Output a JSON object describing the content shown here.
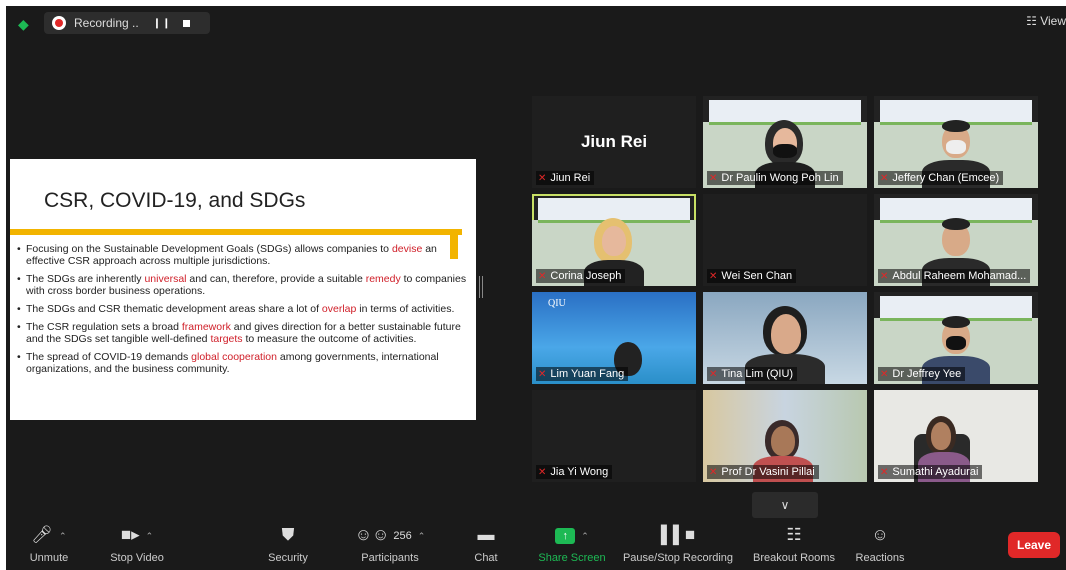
{
  "topbar": {
    "recording_label": "Recording ..",
    "pause_icon": "pause-icon",
    "stop_icon": "stop-icon",
    "view_label": "View"
  },
  "slide": {
    "title": "CSR, COVID-19, and SDGs",
    "bullets": [
      {
        "parts": [
          "Focusing on the Sustainable Development Goals (SDGs) allows companies to ",
          "devise",
          " an effective CSR approach across multiple jurisdictions."
        ]
      },
      {
        "parts": [
          "The SDGs are inherently ",
          "universal",
          " and can, therefore, provide a suitable ",
          "remedy",
          " to companies with cross border business operations."
        ]
      },
      {
        "parts": [
          "The SDGs and CSR thematic development areas share a lot of ",
          "overlap",
          " in terms of activities."
        ]
      },
      {
        "parts": [
          "The CSR regulation sets a broad ",
          "framework",
          " and gives direction for a better sustainable future and the SDGs set tangible well-defined ",
          "targets",
          " to measure the outcome of activities."
        ]
      },
      {
        "parts": [
          "The spread of COVID-19 demands ",
          "global cooperation",
          " among governments, international organizations, and the business community."
        ]
      }
    ]
  },
  "participants_grid": {
    "tiles": [
      {
        "name": "Jiun Rei",
        "big_name": "Jiun Rei"
      },
      {
        "name": "Dr Paulin Wong Poh Lin"
      },
      {
        "name": "Jeffery Chan (Emcee)"
      },
      {
        "name": "Corina Joseph"
      },
      {
        "name": "Wei Sen Chan"
      },
      {
        "name": "Abdul Raheem Mohamad..."
      },
      {
        "name": "Lim Yuan Fang",
        "logo": "QIU"
      },
      {
        "name": "Tina Lim (QIU)"
      },
      {
        "name": "Dr Jeffrey Yee"
      },
      {
        "name": "Jia Yi Wong"
      },
      {
        "name": "Prof Dr Vasini Pillai"
      },
      {
        "name": "Sumathi Ayadurai"
      }
    ]
  },
  "toolbar": {
    "unmute": "Unmute",
    "stop_video": "Stop Video",
    "security": "Security",
    "participants": "Participants",
    "participants_count": "256",
    "chat": "Chat",
    "share_screen": "Share Screen",
    "pause_stop_recording": "Pause/Stop Recording",
    "breakout_rooms": "Breakout Rooms",
    "reactions": "Reactions",
    "leave": "Leave"
  },
  "colors": {
    "accent_green": "#1db954",
    "leave_red": "#e02828",
    "highlight_red": "#d0202a",
    "slide_bar": "#f2b400",
    "active_speaker": "#c8e065"
  }
}
